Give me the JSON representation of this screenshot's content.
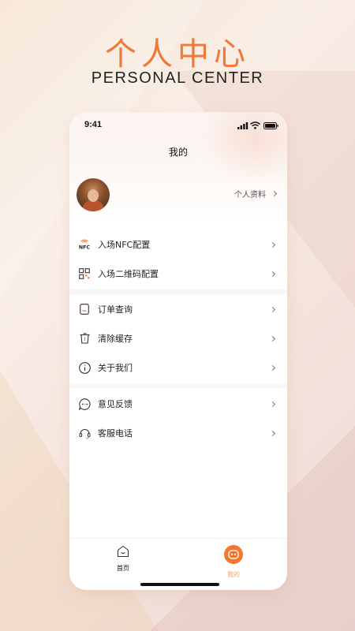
{
  "hero": {
    "title": "个人中心",
    "subtitle": "PERSONAL CENTER"
  },
  "status_bar": {
    "time": "9:41",
    "icons": [
      "signal-icon",
      "wifi-icon",
      "battery-icon"
    ]
  },
  "page": {
    "title": "我的"
  },
  "profile": {
    "link_label": "个人资料"
  },
  "menu": {
    "groups": [
      {
        "items": [
          {
            "label": "入场NFC配置",
            "icon": "nfc-icon"
          },
          {
            "label": "入场二维码配置",
            "icon": "qr-code-icon"
          }
        ]
      },
      {
        "items": [
          {
            "label": "订单查询",
            "icon": "order-icon"
          },
          {
            "label": "清除缓存",
            "icon": "trash-icon"
          },
          {
            "label": "关于我们",
            "icon": "info-icon"
          }
        ]
      },
      {
        "items": [
          {
            "label": "意见反馈",
            "icon": "feedback-icon"
          },
          {
            "label": "客服电话",
            "icon": "headset-icon"
          }
        ]
      }
    ]
  },
  "tabs": [
    {
      "label": "首页",
      "icon": "home-icon",
      "active": false
    },
    {
      "label": "我的",
      "icon": "mine-icon",
      "active": true
    }
  ],
  "colors": {
    "accent": "#f07838",
    "tab_active": "#f27a30"
  }
}
